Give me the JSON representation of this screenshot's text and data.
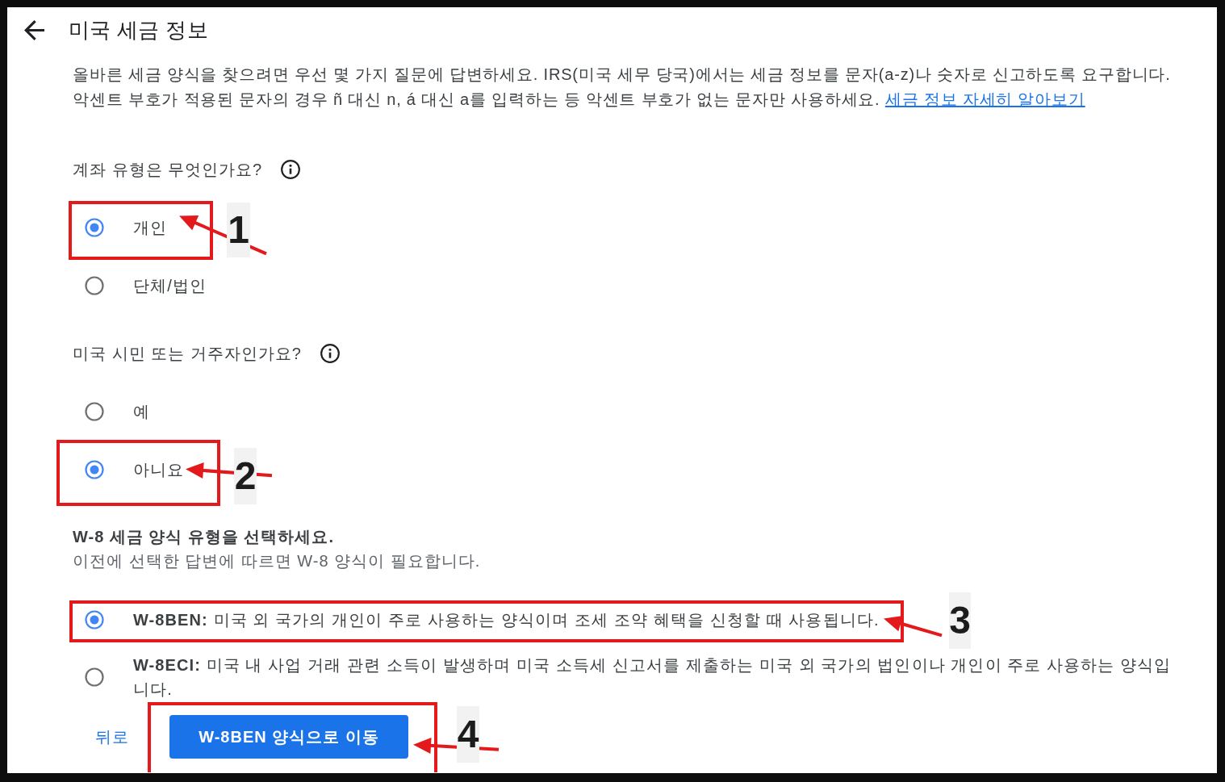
{
  "header": {
    "title": "미국 세금 정보"
  },
  "description": {
    "text": "올바른 세금 양식을 찾으려면 우선 몇 가지 질문에 답변하세요. IRS(미국 세무 당국)에서는 세금 정보를 문자(a-z)나 숫자로 신고하도록 요구합니다. 악센트 부호가 적용된 문자의 경우 ñ 대신 n, á 대신 a를 입력하는 등 악센트 부호가 없는 문자만 사용하세요.",
    "link": "세금 정보 자세히 알아보기"
  },
  "questions": [
    {
      "label": "계좌 유형은 무엇인가요?",
      "options": [
        {
          "label": "개인",
          "selected": true,
          "callout": "1"
        },
        {
          "label": "단체/법인",
          "selected": false
        }
      ]
    },
    {
      "label": "미국 시민 또는 거주자인가요?",
      "options": [
        {
          "label": "예",
          "selected": false
        },
        {
          "label": "아니요",
          "selected": true,
          "callout": "2"
        }
      ]
    }
  ],
  "form_type": {
    "title": "W-8 세금 양식 유형을 선택하세요.",
    "subtitle": "이전에 선택한 답변에 따르면 W-8 양식이 필요합니다.",
    "options": [
      {
        "label": "**W-8BEN:** 미국 외 국가의 개인이 주로 사용하는 양식이며 조세 조약 혜택을 신청할 때 사용됩니다.",
        "selected": true,
        "callout": "3"
      },
      {
        "label": "**W-8ECI:** 미국 내 사업 거래 관련 소득이 발생하며 미국 소득세 신고서를 제출하는 미국 외 국가의 법인이나 개인이 주로 사용하는 양식입니다.",
        "selected": false
      }
    ]
  },
  "actions": [
    {
      "label": "뒤로",
      "kind": "text"
    },
    {
      "label": "W-8BEN 양식으로 이동",
      "kind": "primary",
      "callout": "4"
    }
  ]
}
